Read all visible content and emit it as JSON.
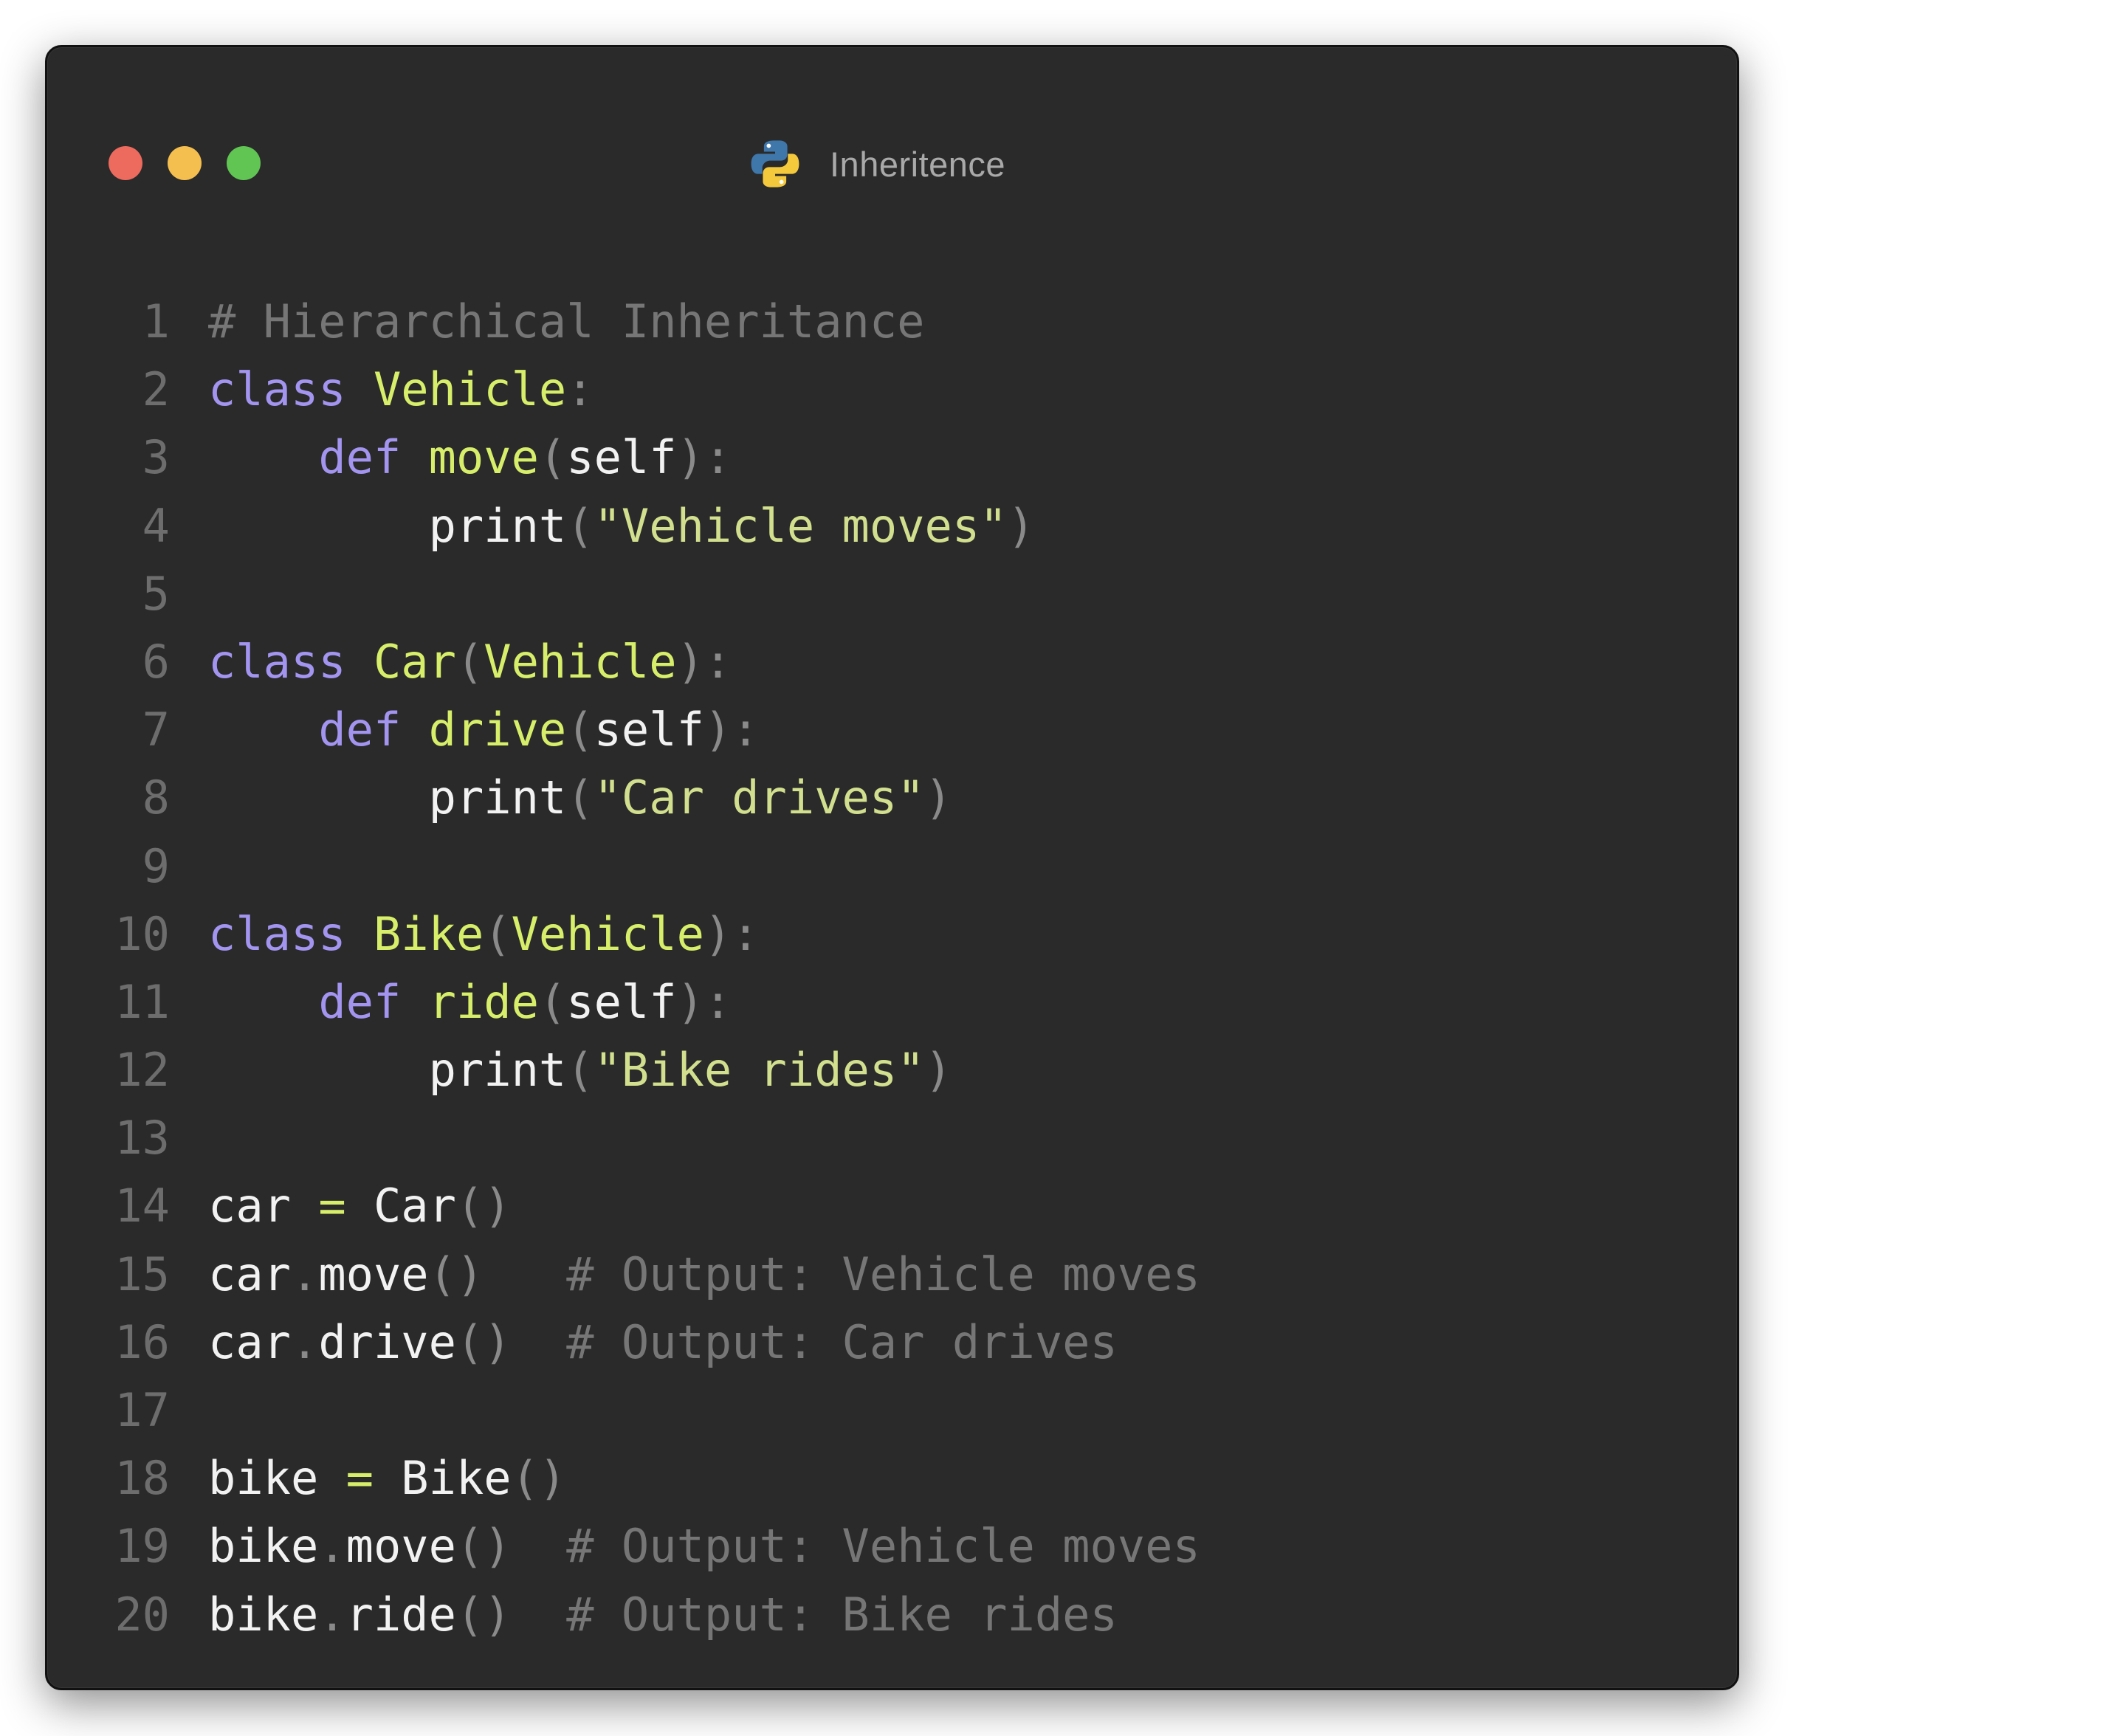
{
  "window": {
    "title": "Inheritence",
    "title_icon": "python-logo-icon",
    "traffic_lights": {
      "close_color": "#ed6a5e",
      "minimize_color": "#f5bf4f",
      "maximize_color": "#61c554"
    }
  },
  "colors": {
    "background": "#2a2a2a",
    "keyword": "#a394f0",
    "function_name": "#d6ee6a",
    "string": "#d2df8e",
    "comment": "#767676",
    "punctuation": "#8a8a8a",
    "text": "#f2f2f2",
    "line_number": "#6d6d6d"
  },
  "code": {
    "language": "python",
    "lines": [
      {
        "n": "1",
        "tokens": [
          {
            "t": "cm",
            "v": "# Hierarchical Inheritance"
          }
        ]
      },
      {
        "n": "2",
        "tokens": [
          {
            "t": "kw",
            "v": "class"
          },
          {
            "t": "tx",
            "v": " "
          },
          {
            "t": "fn",
            "v": "Vehicle"
          },
          {
            "t": "pn",
            "v": ":"
          }
        ]
      },
      {
        "n": "3",
        "tokens": [
          {
            "t": "tx",
            "v": "    "
          },
          {
            "t": "kw",
            "v": "def"
          },
          {
            "t": "tx",
            "v": " "
          },
          {
            "t": "fn",
            "v": "move"
          },
          {
            "t": "pn",
            "v": "("
          },
          {
            "t": "tx",
            "v": "self"
          },
          {
            "t": "pn",
            "v": "):"
          }
        ]
      },
      {
        "n": "4",
        "tokens": [
          {
            "t": "tx",
            "v": "        print"
          },
          {
            "t": "pn",
            "v": "("
          },
          {
            "t": "str",
            "v": "\"Vehicle moves\""
          },
          {
            "t": "pn",
            "v": ")"
          }
        ]
      },
      {
        "n": "5",
        "tokens": []
      },
      {
        "n": "6",
        "tokens": [
          {
            "t": "kw",
            "v": "class"
          },
          {
            "t": "tx",
            "v": " "
          },
          {
            "t": "fn",
            "v": "Car"
          },
          {
            "t": "pn",
            "v": "("
          },
          {
            "t": "fn",
            "v": "Vehicle"
          },
          {
            "t": "pn",
            "v": "):"
          }
        ]
      },
      {
        "n": "7",
        "tokens": [
          {
            "t": "tx",
            "v": "    "
          },
          {
            "t": "kw",
            "v": "def"
          },
          {
            "t": "tx",
            "v": " "
          },
          {
            "t": "fn",
            "v": "drive"
          },
          {
            "t": "pn",
            "v": "("
          },
          {
            "t": "tx",
            "v": "self"
          },
          {
            "t": "pn",
            "v": "):"
          }
        ]
      },
      {
        "n": "8",
        "tokens": [
          {
            "t": "tx",
            "v": "        print"
          },
          {
            "t": "pn",
            "v": "("
          },
          {
            "t": "str",
            "v": "\"Car drives\""
          },
          {
            "t": "pn",
            "v": ")"
          }
        ]
      },
      {
        "n": "9",
        "tokens": []
      },
      {
        "n": "10",
        "tokens": [
          {
            "t": "kw",
            "v": "class"
          },
          {
            "t": "tx",
            "v": " "
          },
          {
            "t": "fn",
            "v": "Bike"
          },
          {
            "t": "pn",
            "v": "("
          },
          {
            "t": "fn",
            "v": "Vehicle"
          },
          {
            "t": "pn",
            "v": "):"
          }
        ]
      },
      {
        "n": "11",
        "tokens": [
          {
            "t": "tx",
            "v": "    "
          },
          {
            "t": "kw",
            "v": "def"
          },
          {
            "t": "tx",
            "v": " "
          },
          {
            "t": "fn",
            "v": "ride"
          },
          {
            "t": "pn",
            "v": "("
          },
          {
            "t": "tx",
            "v": "self"
          },
          {
            "t": "pn",
            "v": "):"
          }
        ]
      },
      {
        "n": "12",
        "tokens": [
          {
            "t": "tx",
            "v": "        print"
          },
          {
            "t": "pn",
            "v": "("
          },
          {
            "t": "str",
            "v": "\"Bike rides\""
          },
          {
            "t": "pn",
            "v": ")"
          }
        ]
      },
      {
        "n": "13",
        "tokens": []
      },
      {
        "n": "14",
        "tokens": [
          {
            "t": "tx",
            "v": "car "
          },
          {
            "t": "fn",
            "v": "="
          },
          {
            "t": "tx",
            "v": " Car"
          },
          {
            "t": "pn",
            "v": "()"
          }
        ]
      },
      {
        "n": "15",
        "tokens": [
          {
            "t": "tx",
            "v": "car"
          },
          {
            "t": "pn",
            "v": "."
          },
          {
            "t": "tx",
            "v": "move"
          },
          {
            "t": "pn",
            "v": "()"
          },
          {
            "t": "tx",
            "v": "   "
          },
          {
            "t": "cm",
            "v": "# Output: Vehicle moves"
          }
        ]
      },
      {
        "n": "16",
        "tokens": [
          {
            "t": "tx",
            "v": "car"
          },
          {
            "t": "pn",
            "v": "."
          },
          {
            "t": "tx",
            "v": "drive"
          },
          {
            "t": "pn",
            "v": "()"
          },
          {
            "t": "tx",
            "v": "  "
          },
          {
            "t": "cm",
            "v": "# Output: Car drives"
          }
        ]
      },
      {
        "n": "17",
        "tokens": []
      },
      {
        "n": "18",
        "tokens": [
          {
            "t": "tx",
            "v": "bike "
          },
          {
            "t": "fn",
            "v": "="
          },
          {
            "t": "tx",
            "v": " Bike"
          },
          {
            "t": "pn",
            "v": "()"
          }
        ]
      },
      {
        "n": "19",
        "tokens": [
          {
            "t": "tx",
            "v": "bike"
          },
          {
            "t": "pn",
            "v": "."
          },
          {
            "t": "tx",
            "v": "move"
          },
          {
            "t": "pn",
            "v": "()"
          },
          {
            "t": "tx",
            "v": "  "
          },
          {
            "t": "cm",
            "v": "# Output: Vehicle moves"
          }
        ]
      },
      {
        "n": "20",
        "tokens": [
          {
            "t": "tx",
            "v": "bike"
          },
          {
            "t": "pn",
            "v": "."
          },
          {
            "t": "tx",
            "v": "ride"
          },
          {
            "t": "pn",
            "v": "()"
          },
          {
            "t": "tx",
            "v": "  "
          },
          {
            "t": "cm",
            "v": "# Output: Bike rides"
          }
        ]
      }
    ]
  }
}
